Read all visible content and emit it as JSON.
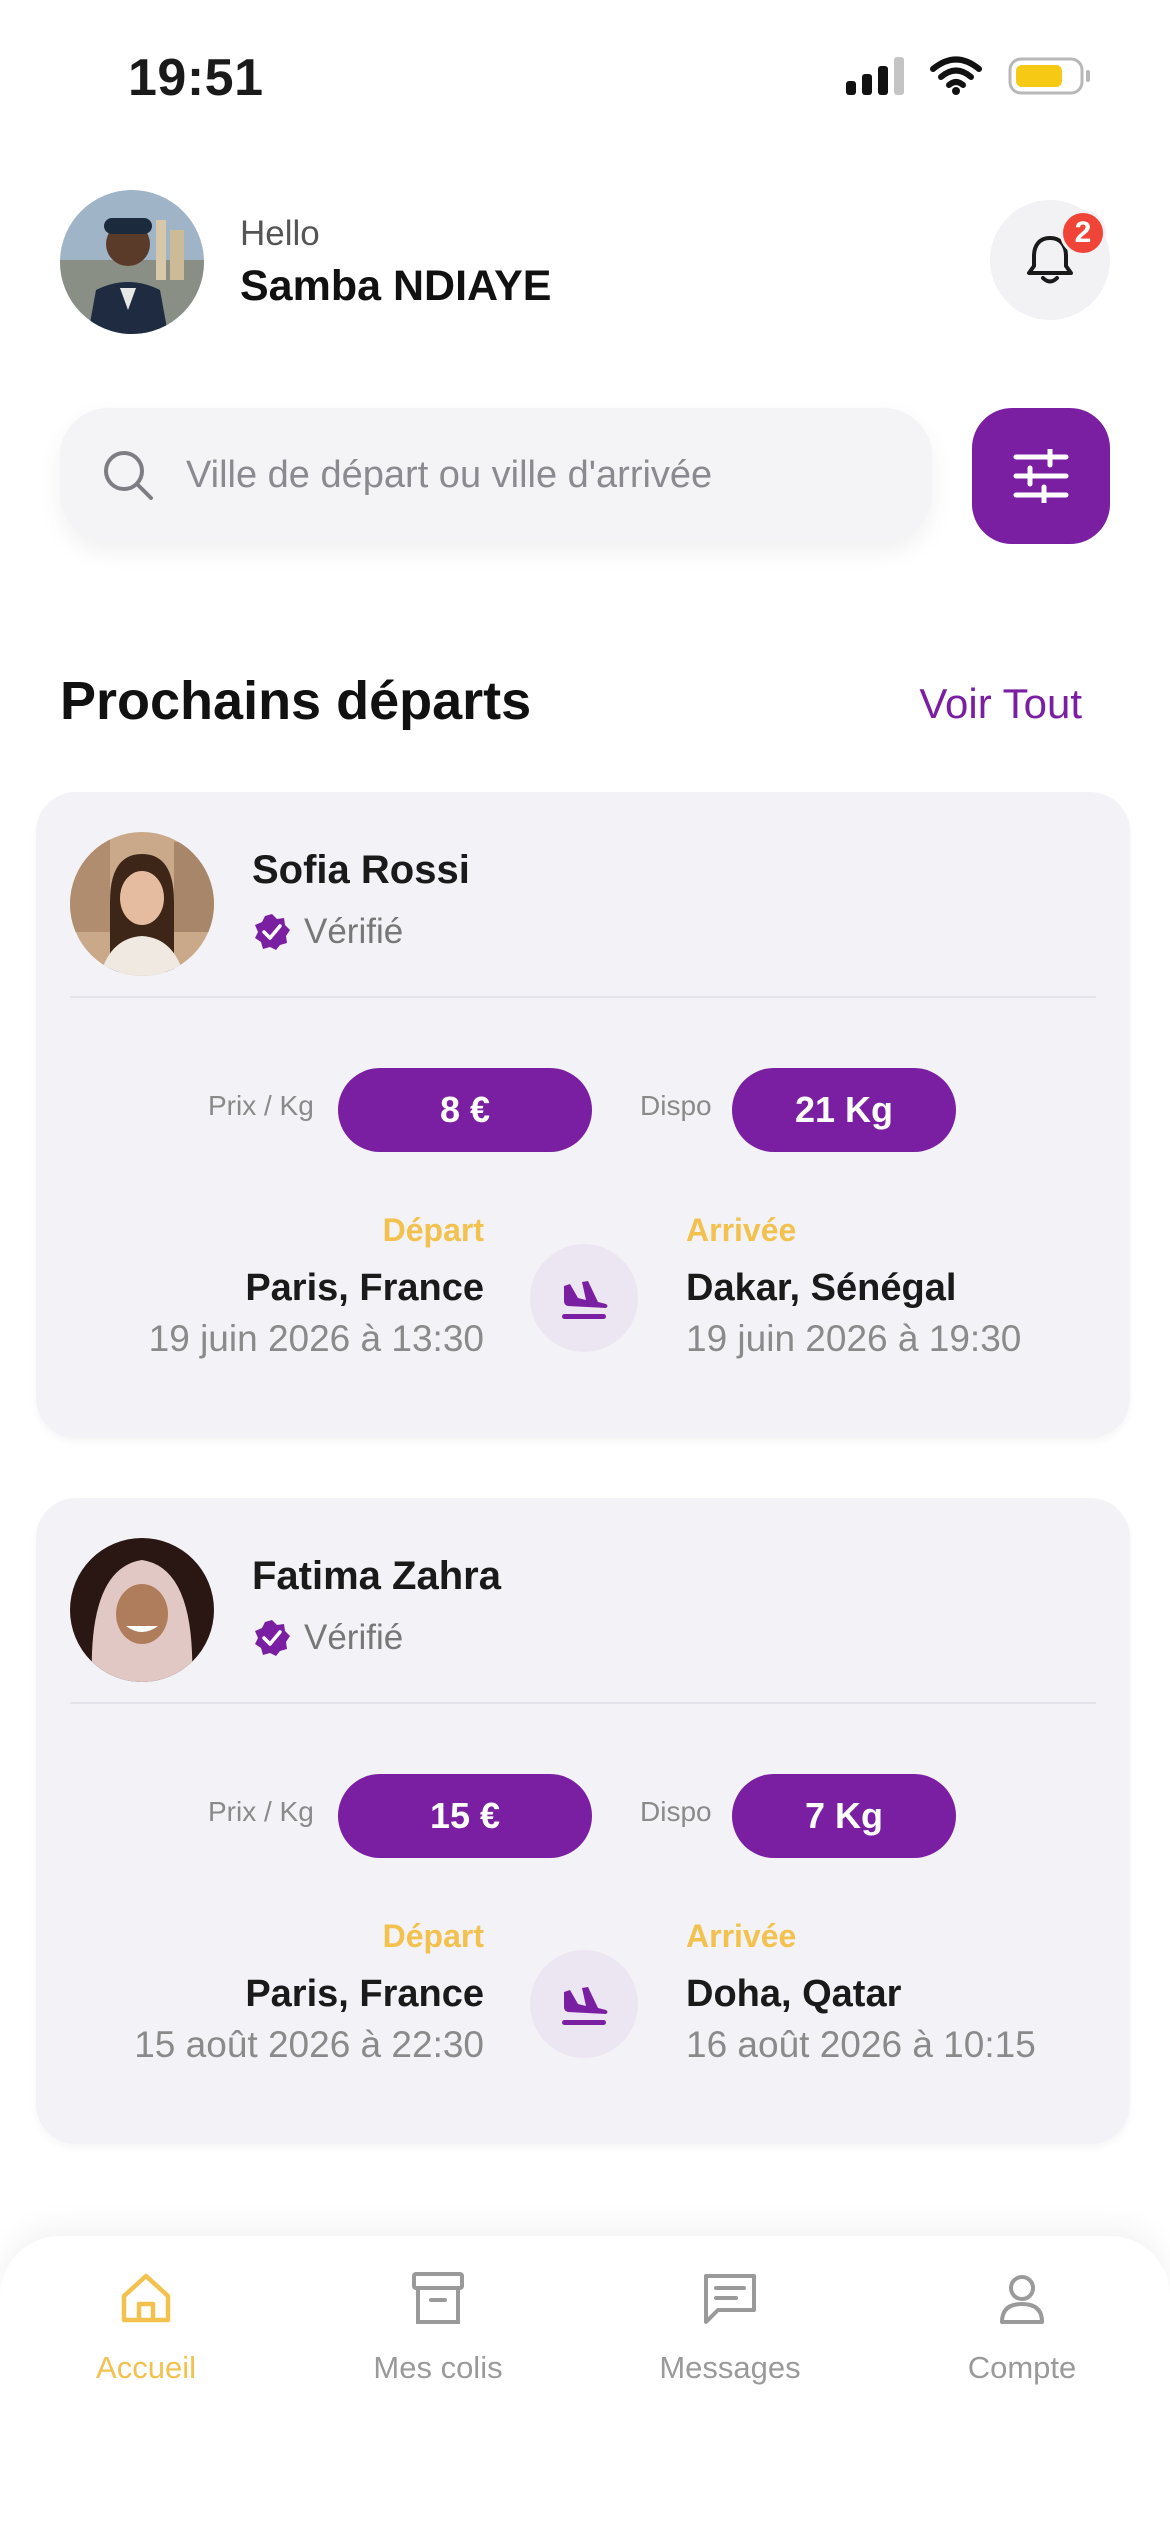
{
  "status_bar": {
    "time": "19:51"
  },
  "header": {
    "greeting": "Hello",
    "user_name": "Samba NDIAYE",
    "notification_count": "2"
  },
  "search": {
    "placeholder": "Ville de départ ou ville d'arrivée"
  },
  "section": {
    "title": "Prochains départs",
    "see_all": "Voir Tout"
  },
  "trips": [
    {
      "traveler": "Sofia Rossi",
      "status": "Vérifié",
      "price_label": "Prix / Kg",
      "price": "8 €",
      "dispo_label": "Dispo",
      "dispo": "21 Kg",
      "depart_label": "Départ",
      "depart_city": "Paris, France",
      "depart_date": "19 juin 2026 à 13:30",
      "arrive_label": "Arrivée",
      "arrive_city": "Dakar, Sénégal",
      "arrive_date": "19 juin 2026 à 19:30"
    },
    {
      "traveler": "Fatima Zahra",
      "status": "Vérifié",
      "price_label": "Prix / Kg",
      "price": "15 €",
      "dispo_label": "Dispo",
      "dispo": "7 Kg",
      "depart_label": "Départ",
      "depart_city": "Paris, France",
      "depart_date": "15 août 2026 à 22:30",
      "arrive_label": "Arrivée",
      "arrive_city": "Doha, Qatar",
      "arrive_date": "16 août 2026 à 10:15"
    }
  ],
  "nav": [
    {
      "label": "Accueil",
      "icon": "home-icon",
      "active": true
    },
    {
      "label": "Mes colis",
      "icon": "archive-box-icon",
      "active": false
    },
    {
      "label": "Messages",
      "icon": "message-icon",
      "active": false
    },
    {
      "label": "Compte",
      "icon": "user-icon",
      "active": false
    }
  ],
  "colors": {
    "accent": "#7a1fa2",
    "highlight": "#f2c14e",
    "badge": "#f04438"
  }
}
